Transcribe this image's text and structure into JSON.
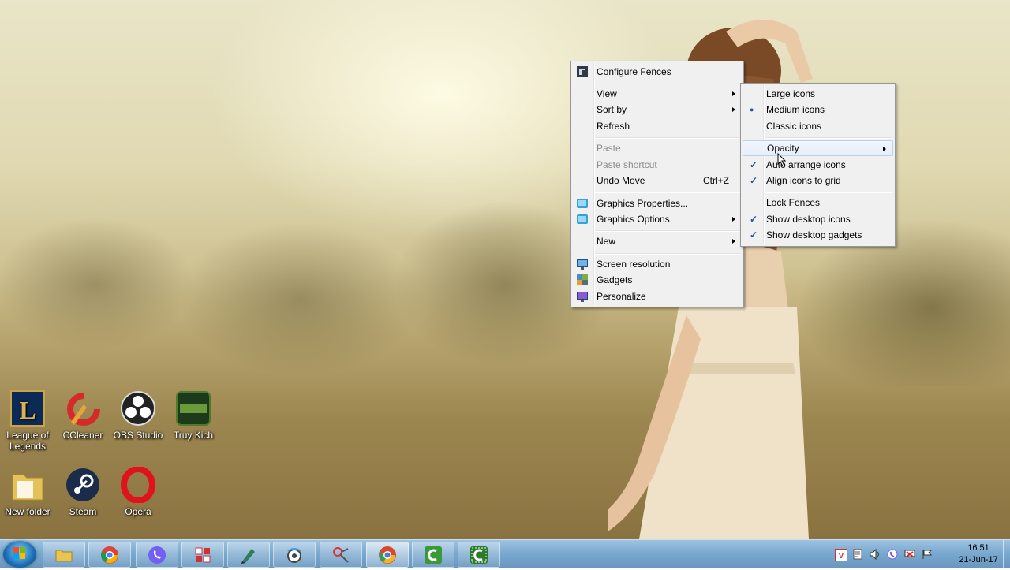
{
  "desktop": {
    "icons": [
      {
        "label": "League of Legends",
        "icon": "league-of-legends-icon"
      },
      {
        "label": "CCleaner",
        "icon": "ccleaner-icon"
      },
      {
        "label": "OBS Studio",
        "icon": "obs-studio-icon"
      },
      {
        "label": "Truy Kich",
        "icon": "truy-kich-icon"
      },
      {
        "label": "New folder",
        "icon": "folder-icon"
      },
      {
        "label": "Steam",
        "icon": "steam-icon"
      },
      {
        "label": "Opera",
        "icon": "opera-icon"
      }
    ]
  },
  "context_menu": {
    "items": [
      {
        "label": "Configure Fences",
        "icon": "fences-icon"
      },
      {
        "label": "View",
        "has_submenu": true,
        "highlighted": true
      },
      {
        "label": "Sort by",
        "has_submenu": true
      },
      {
        "label": "Refresh"
      },
      {
        "label": "Paste",
        "disabled": true
      },
      {
        "label": "Paste shortcut",
        "disabled": true
      },
      {
        "label": "Undo Move",
        "shortcut": "Ctrl+Z"
      },
      {
        "label": "Graphics Properties...",
        "icon": "intel-graphics-icon"
      },
      {
        "label": "Graphics Options",
        "icon": "intel-graphics-icon",
        "has_submenu": true
      },
      {
        "label": "New",
        "has_submenu": true
      },
      {
        "label": "Screen resolution",
        "icon": "screen-resolution-icon"
      },
      {
        "label": "Gadgets",
        "icon": "gadgets-icon"
      },
      {
        "label": "Personalize",
        "icon": "personalize-icon"
      }
    ]
  },
  "view_submenu": {
    "items": [
      {
        "label": "Large icons"
      },
      {
        "label": "Medium icons",
        "selected": true
      },
      {
        "label": "Classic icons"
      },
      {
        "label": "Opacity",
        "has_submenu": true,
        "highlighted": true
      },
      {
        "label": "Auto arrange icons",
        "checked": true
      },
      {
        "label": "Align icons to grid",
        "checked": true
      },
      {
        "label": "Lock Fences"
      },
      {
        "label": "Show desktop icons",
        "checked": true
      },
      {
        "label": "Show desktop gadgets",
        "checked": true
      }
    ],
    "check_mark": "✓",
    "radio_mark": "●"
  },
  "taskbar": {
    "start": "windows-start-icon",
    "pinned": [
      "file-explorer-icon",
      "chrome-icon",
      "viber-icon",
      "app-icon",
      "pen-tool-icon",
      "browser-icon",
      "snipping-tool-icon",
      "chrome-canary-icon",
      "camtasia-icon",
      "camtasia-recorder-icon"
    ],
    "active_index": 7,
    "tray_icons": [
      "vietkey-icon",
      "notes-icon",
      "volume-icon",
      "viber-tray-icon",
      "network-icon",
      "flag-icon",
      "action-center-icon"
    ],
    "clock_time": "16:51",
    "clock_date": "21-Jun-17"
  }
}
